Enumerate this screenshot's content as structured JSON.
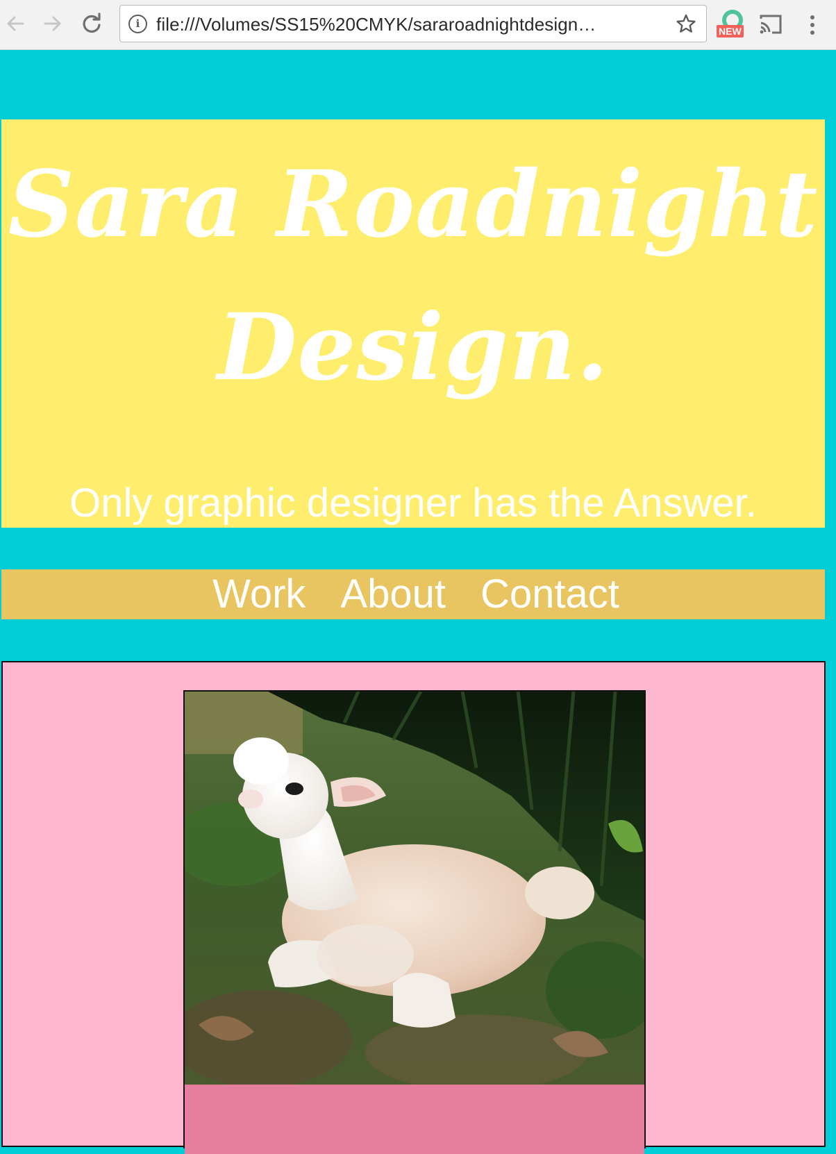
{
  "browser": {
    "url": "file:///Volumes/SS15%20CMYK/sararoadnightdesign…",
    "extension_badge": "NEW"
  },
  "header": {
    "title": "Sara Roadnight Design.",
    "tagline": "Only graphic designer has the Answer.",
    "background_color": "#ffee6d"
  },
  "nav": {
    "items": [
      {
        "label": "Work"
      },
      {
        "label": "About"
      },
      {
        "label": "Contact"
      }
    ],
    "background_color": "#e8c560"
  },
  "content": {
    "background_color": "#ffb6cf",
    "card_footer_color": "#e47f9e",
    "image_subject": "felted baby alpaca lying on grass"
  },
  "page": {
    "background_color": "#00cdd6"
  }
}
